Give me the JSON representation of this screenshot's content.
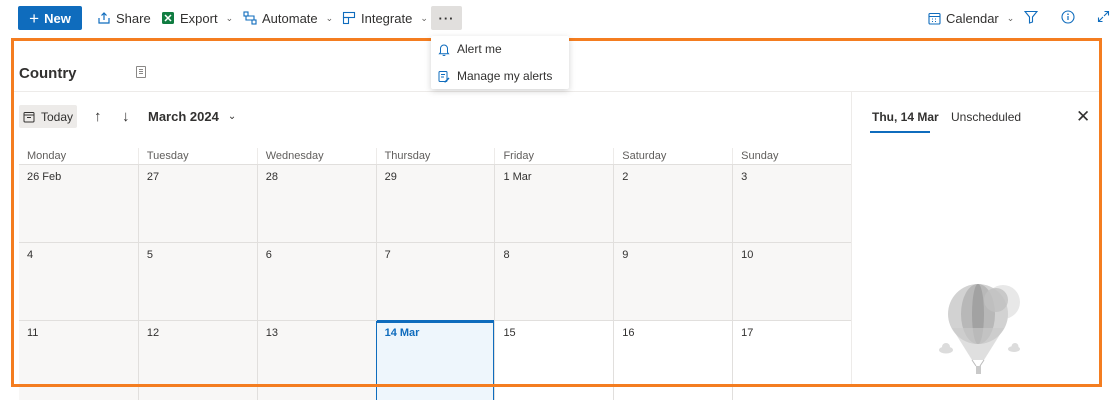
{
  "toolbar": {
    "new_label": "New",
    "share_label": "Share",
    "export_label": "Export",
    "automate_label": "Automate",
    "integrate_label": "Integrate",
    "more_label": "···",
    "view_label": "Calendar"
  },
  "menu": {
    "items": [
      {
        "label": "Alert me",
        "icon": "bell-icon"
      },
      {
        "label": "Manage my alerts",
        "icon": "edit-alerts-icon"
      }
    ]
  },
  "list": {
    "title": "Country"
  },
  "calendar": {
    "today_label": "Today",
    "month_label": "March 2024",
    "day_headers": [
      "Monday",
      "Tuesday",
      "Wednesday",
      "Thursday",
      "Friday",
      "Saturday",
      "Sunday"
    ],
    "weeks": [
      [
        "26 Feb",
        "27",
        "28",
        "29",
        "1 Mar",
        "2",
        "3"
      ],
      [
        "4",
        "5",
        "6",
        "7",
        "8",
        "9",
        "10"
      ],
      [
        "11",
        "12",
        "13",
        "14 Mar",
        "15",
        "16",
        "17"
      ]
    ]
  },
  "panel": {
    "tab_selected": "Thu, 14 Mar",
    "tab_unscheduled": "Unscheduled"
  },
  "colors": {
    "accent": "#0f6cbd",
    "highlight_frame": "#f47d20"
  }
}
